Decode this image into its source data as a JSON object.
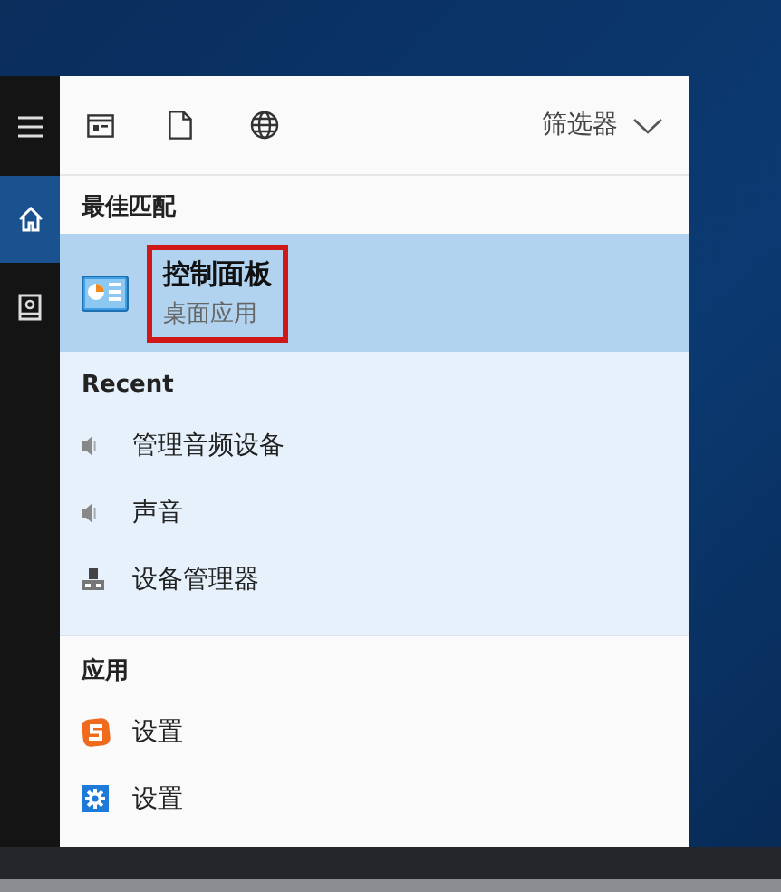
{
  "sidebar": {
    "items": [
      {
        "kind": "home",
        "selected": true
      },
      {
        "kind": "notebook",
        "selected": false
      }
    ]
  },
  "toolbar": {
    "tools": [
      {
        "kind": "apps"
      },
      {
        "kind": "document"
      },
      {
        "kind": "web"
      }
    ],
    "filter": {
      "label": "筛选器"
    }
  },
  "best_match": {
    "heading": "最佳匹配",
    "item": {
      "kind": "control-panel",
      "title": "控制面板",
      "subtitle": "桌面应用",
      "selected": true,
      "outlined": true
    }
  },
  "recent": {
    "heading": "Recent",
    "items": [
      {
        "kind": "speaker",
        "label": "管理音频设备"
      },
      {
        "kind": "speaker",
        "label": "声音"
      },
      {
        "kind": "device",
        "label": "设备管理器"
      }
    ]
  },
  "apps": {
    "heading": "应用",
    "items": [
      {
        "kind": "sogou",
        "label": "设置"
      },
      {
        "kind": "gear",
        "label": "设置"
      }
    ]
  }
}
